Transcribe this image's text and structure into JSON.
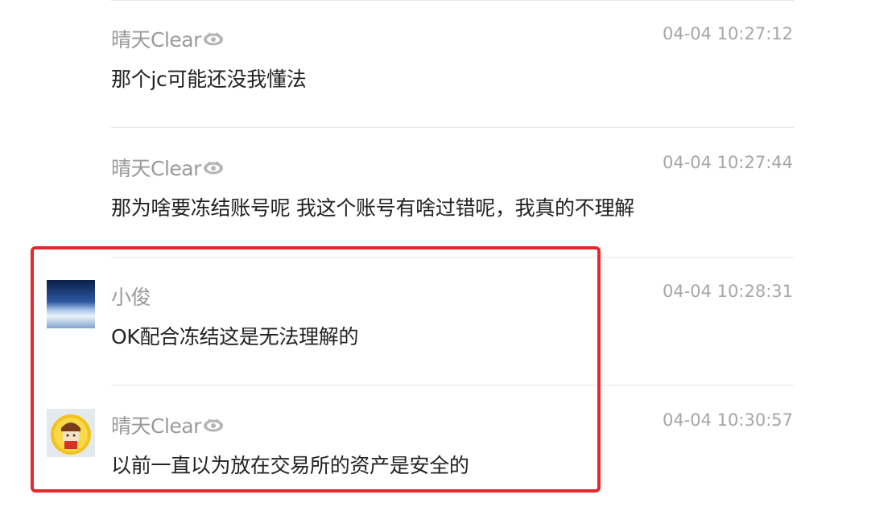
{
  "accent_color": "#e8262b",
  "messages": [
    {
      "user": "晴天Clear",
      "time": "04-04 10:27:12",
      "text": "那个jc可能还没我懂法",
      "badge_icon": "verified-eye-icon",
      "avatar": null
    },
    {
      "user": "晴天Clear",
      "time": "04-04 10:27:44",
      "text": "那为啥要冻结账号呢 我这个账号有啥过错呢，我真的不理解",
      "badge_icon": "verified-eye-icon",
      "avatar": null
    },
    {
      "user": "小俊",
      "time": "04-04 10:28:31",
      "text": "OK配合冻结这是无法理解的",
      "avatar": "sky-horizon-avatar"
    },
    {
      "user": "晴天Clear",
      "time": "04-04 10:30:57",
      "text": "以前一直以为放在交易所的资产是安全的",
      "badge_icon": "verified-eye-icon",
      "avatar": "cartoon-girl-avatar"
    }
  ]
}
